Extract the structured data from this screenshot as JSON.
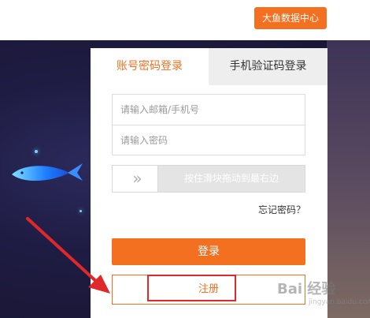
{
  "header": {
    "data_center_label": "大鱼数据中心"
  },
  "login": {
    "tabs": [
      {
        "label": "账号密码登录",
        "active": true
      },
      {
        "label": "手机验证码登录",
        "active": false
      }
    ],
    "account_placeholder": "请输入邮箱/手机号",
    "password_placeholder": "请输入密码",
    "slider_hint": "按住滑块拖动到最右边",
    "forgot_label": "忘记密码？",
    "login_label": "登录",
    "register_label": "注册"
  },
  "watermark": {
    "text": "Bai 经验",
    "sub": "jingyan.baidu.com"
  },
  "colors": {
    "accent": "#f37021",
    "annotation": "#e0282a"
  },
  "icons": {
    "slider_handle": "double-chevron-right-icon"
  }
}
